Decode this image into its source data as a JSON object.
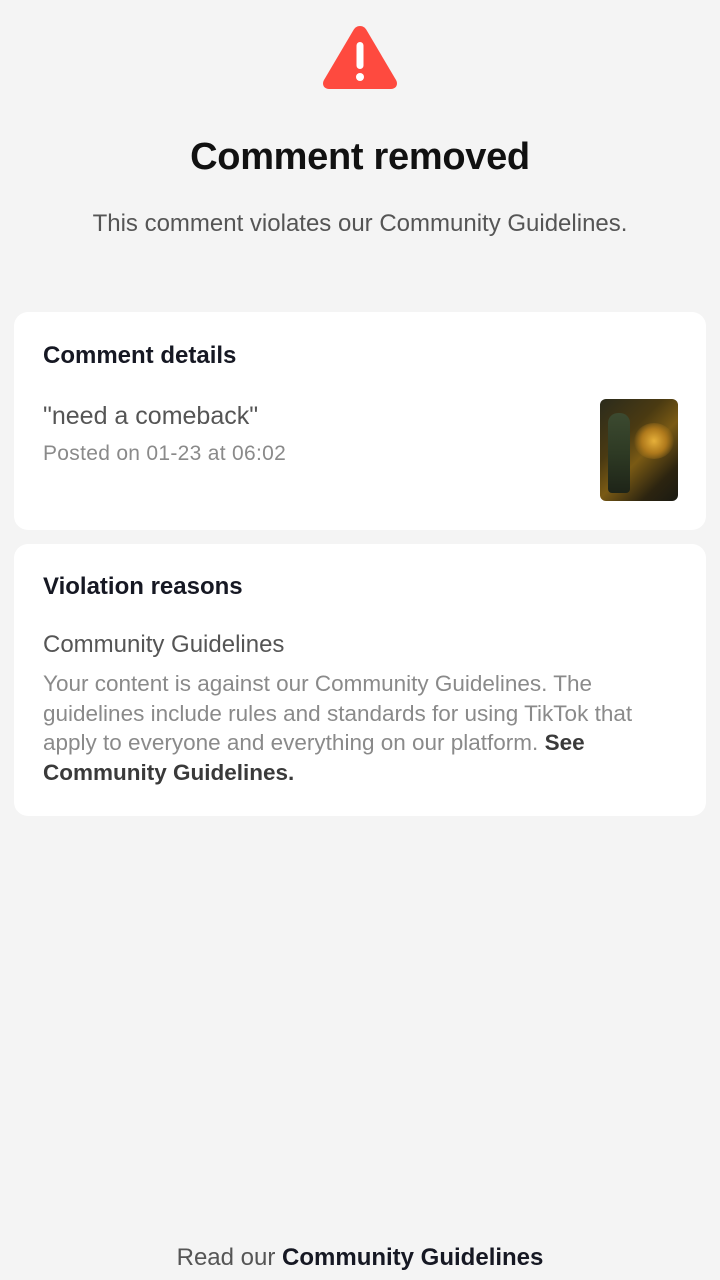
{
  "header": {
    "icon": "warning-triangle-icon",
    "title": "Comment removed",
    "subtitle": "This comment violates our Community Guidelines."
  },
  "comment_details": {
    "heading": "Comment details",
    "comment_text": "\"need a comeback\"",
    "posted": "Posted on 01-23 at 06:02"
  },
  "violation": {
    "heading": "Violation reasons",
    "reason_title": "Community Guidelines",
    "reason_body": "Your content is against our Community Guidelines. The guidelines include rules and standards for using TikTok that apply to everyone and everything on our platform.",
    "link_label": "See Community Guidelines."
  },
  "footer": {
    "prefix": "Read our",
    "link_label": "Community Guidelines"
  },
  "colors": {
    "warning": "#fe4a3f",
    "background": "#f4f4f4",
    "card": "#ffffff"
  }
}
